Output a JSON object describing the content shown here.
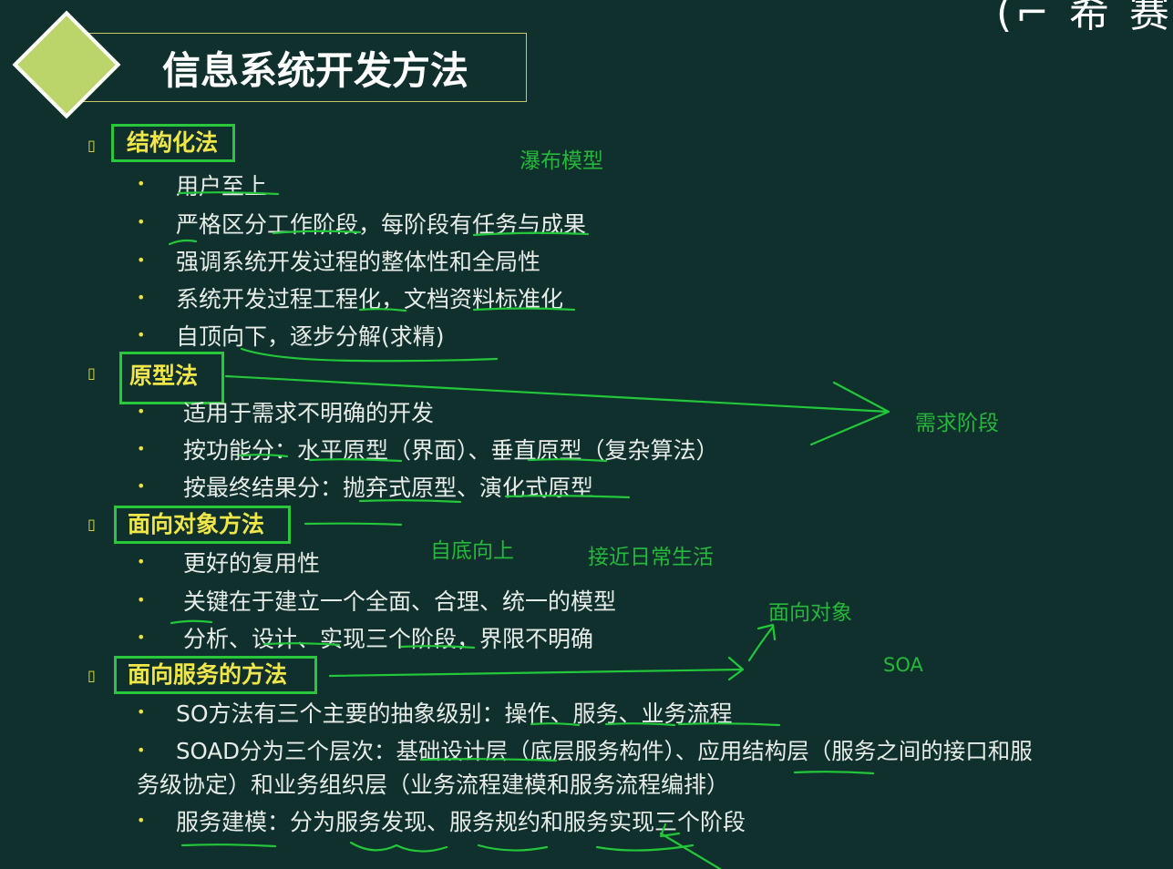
{
  "logo_fragment": "(⌐ 希 赛",
  "title": "信息系统开发方法",
  "section_marker": "▯",
  "bullet_glyph": "•",
  "sections": [
    {
      "label": "结构化法",
      "items": [
        "用户至上",
        "严格区分工作阶段，每阶段有任务与成果",
        "强调系统开发过程的整体性和全局性",
        "系统开发过程工程化，文档资料标准化",
        "自顶向下，逐步分解(求精)"
      ]
    },
    {
      "label": "原型法",
      "items": [
        "适用于需求不明确的开发",
        "按功能分：水平原型（界面）、垂直原型（复杂算法）",
        "按最终结果分：抛弃式原型、演化式原型"
      ]
    },
    {
      "label": "面向对象方法",
      "items": [
        "更好的复用性",
        "关键在于建立一个全面、合理、统一的模型",
        "分析、设计、实现三个阶段，界限不明确"
      ]
    },
    {
      "label": "面向服务的方法",
      "items": [
        "SO方法有三个主要的抽象级别：操作、服务、业务流程",
        "SOAD分为三个层次：基础设计层（底层服务构件）、应用结构层（服务之间的接口和服",
        "务级协定）和业务组织层（业务流程建模和服务流程编排）",
        "服务建模：分为服务发现、服务规约和服务实现三个阶段"
      ]
    }
  ],
  "annotations": {
    "waterfall": "瀑布模型",
    "requirements_phase": "需求阶段",
    "bottom_up": "自底向上",
    "close_to_life": "接近日常生活",
    "object_oriented": "面向对象",
    "soa": "SOA"
  },
  "colors": {
    "background": "#0f302c",
    "heading_yellow": "#f0e64a",
    "box_green": "#28c83a",
    "ink_green": "#26b83a",
    "diamond": "#bcd56a"
  }
}
